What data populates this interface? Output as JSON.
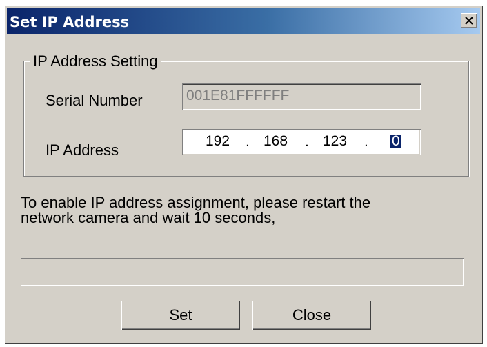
{
  "window": {
    "title": "Set IP Address"
  },
  "group": {
    "legend": "IP Address Setting",
    "serial_label": "Serial Number",
    "serial_value": "001E81FFFFFF",
    "ip_label": "IP Address",
    "ip_octets": [
      "192",
      "168",
      "123",
      "0"
    ],
    "ip_separator": "."
  },
  "message": {
    "line1": "To enable IP address assignment, please restart the",
    "line2": "network camera and wait  10 seconds,"
  },
  "progress": {
    "value_percent": 0
  },
  "buttons": {
    "set_label": "Set",
    "close_label": "Close"
  },
  "icons": {
    "close": "close-icon"
  },
  "colors": {
    "titlebar_start": "#0a246a",
    "titlebar_end": "#a6caf0",
    "dialog_face": "#d4d0c8",
    "selection": "#0a246a"
  }
}
